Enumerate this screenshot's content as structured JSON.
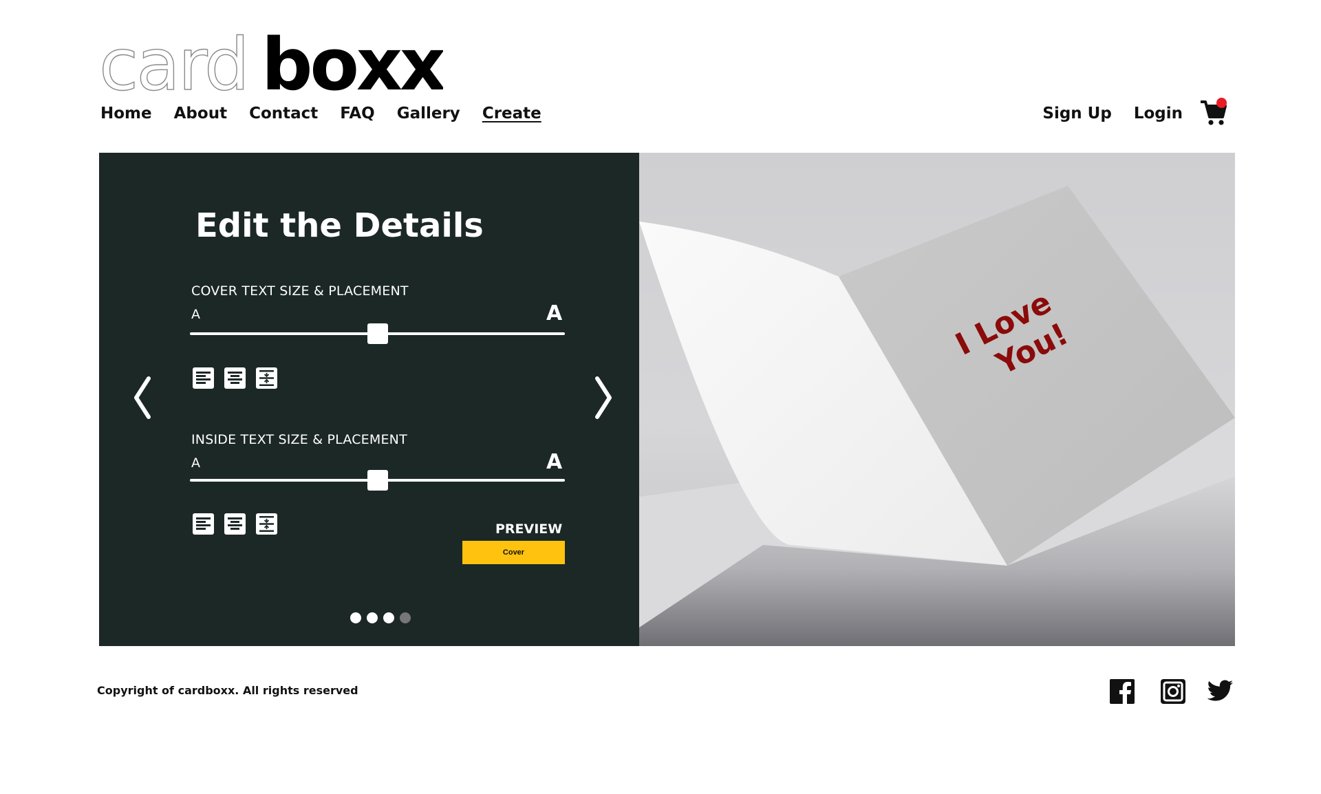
{
  "brand": {
    "logo_light": "card",
    "logo_bold": "boxx"
  },
  "nav": {
    "items": [
      {
        "label": "Home"
      },
      {
        "label": "About"
      },
      {
        "label": "Contact"
      },
      {
        "label": "FAQ"
      },
      {
        "label": "Gallery"
      },
      {
        "label": "Create"
      }
    ],
    "active": "Create"
  },
  "auth": {
    "signup_label": "Sign Up",
    "login_label": "Login"
  },
  "cart": {
    "icon": "shopping-cart-icon",
    "badge_color": "#ea1c24"
  },
  "editor": {
    "title": "Edit the Details",
    "cover": {
      "label": "COVER TEXT SIZE & PLACEMENT",
      "min_glyph": "A",
      "max_glyph": "A",
      "size_value": 0.5
    },
    "inside": {
      "label": "INSIDE TEXT SIZE & PLACEMENT",
      "min_glyph": "A",
      "max_glyph": "A",
      "size_value": 0.5
    },
    "align_icons": [
      "align-left-icon",
      "align-center-icon",
      "vertical-center-icon"
    ],
    "preview_label": "PREVIEW",
    "preview_button": "Cover",
    "prev_icon": "chevron-left-icon",
    "next_icon": "chevron-right-icon",
    "step_total": 4,
    "step_current": 4
  },
  "photo": {
    "card_text_line1": "I Love",
    "card_text_line2": "You!",
    "card_text_color": "#8b0a0a"
  },
  "footer": {
    "copyright": "Copyright of cardboxx. All rights reserved",
    "social_icons": [
      "facebook-icon",
      "instagram-icon",
      "twitter-icon"
    ]
  },
  "colors": {
    "panel_bg": "#1c2826",
    "accent": "#ffc20e",
    "text": "#111111"
  }
}
